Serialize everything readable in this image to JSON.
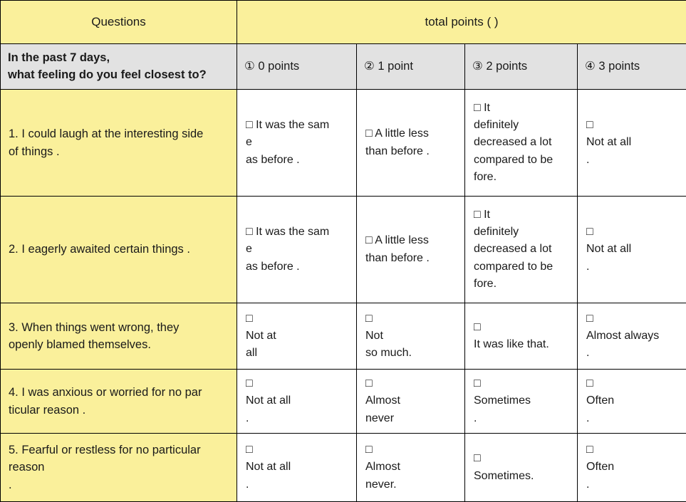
{
  "table": {
    "header": {
      "questions_label": "Questions",
      "total_points_label": "total points ( )"
    },
    "subheader": {
      "prompt_line1": "In the past 7 days,",
      "prompt_line2": "what feeling do you feel closest to?",
      "option_headers": [
        "① 0 points",
        "② 1 point",
        "③ 2 points",
        "④ 3 points"
      ]
    },
    "checkbox_glyph": "□",
    "rows": [
      {
        "question_lines": [
          "1. I could laugh at the interesting side",
          "of things ."
        ],
        "options": [
          [
            "□ It was the sam",
            "e",
            "as before ."
          ],
          [
            "□ A little less",
            "than before ."
          ],
          [
            "□ It",
            "definitely",
            "decreased a lot",
            "compared to be",
            "fore."
          ],
          [
            "□",
            "Not at all",
            "."
          ]
        ]
      },
      {
        "question_lines": [
          "2. I eagerly awaited certain things ."
        ],
        "options": [
          [
            "□ It was the sam",
            "e",
            "as before ."
          ],
          [
            "□ A little less",
            "than before ."
          ],
          [
            "□ It",
            "definitely",
            "decreased a lot",
            "compared to be",
            "fore."
          ],
          [
            "□",
            "Not at all",
            "."
          ]
        ]
      },
      {
        "question_lines": [
          "3. When things went wrong, they",
          "openly blamed themselves."
        ],
        "options": [
          [
            "□",
            "Not at",
            "all"
          ],
          [
            "□",
            "Not",
            "so much."
          ],
          [
            "□",
            "It was like that."
          ],
          [
            "□",
            "Almost always",
            "."
          ]
        ]
      },
      {
        "question_lines": [
          "4. I was anxious or worried for no par",
          "ticular reason ."
        ],
        "options": [
          [
            "□",
            "Not at all",
            "."
          ],
          [
            "□",
            "Almost",
            "never"
          ],
          [
            "□",
            "Sometimes",
            "."
          ],
          [
            "□",
            "Often",
            "."
          ]
        ]
      },
      {
        "question_lines": [
          "5. Fearful or restless for no particular",
          "reason",
          "."
        ],
        "options": [
          [
            "□",
            "Not at all",
            "."
          ],
          [
            "□",
            "Almost",
            "never."
          ],
          [
            "□",
            "Sometimes."
          ],
          [
            "□",
            "Often",
            "."
          ]
        ]
      }
    ],
    "colors": {
      "header_yellow": "#faf09b",
      "subheader_gray": "#e2e2e2",
      "cell_white": "#ffffff",
      "border": "#000000",
      "text": "#1a1a1a"
    }
  }
}
